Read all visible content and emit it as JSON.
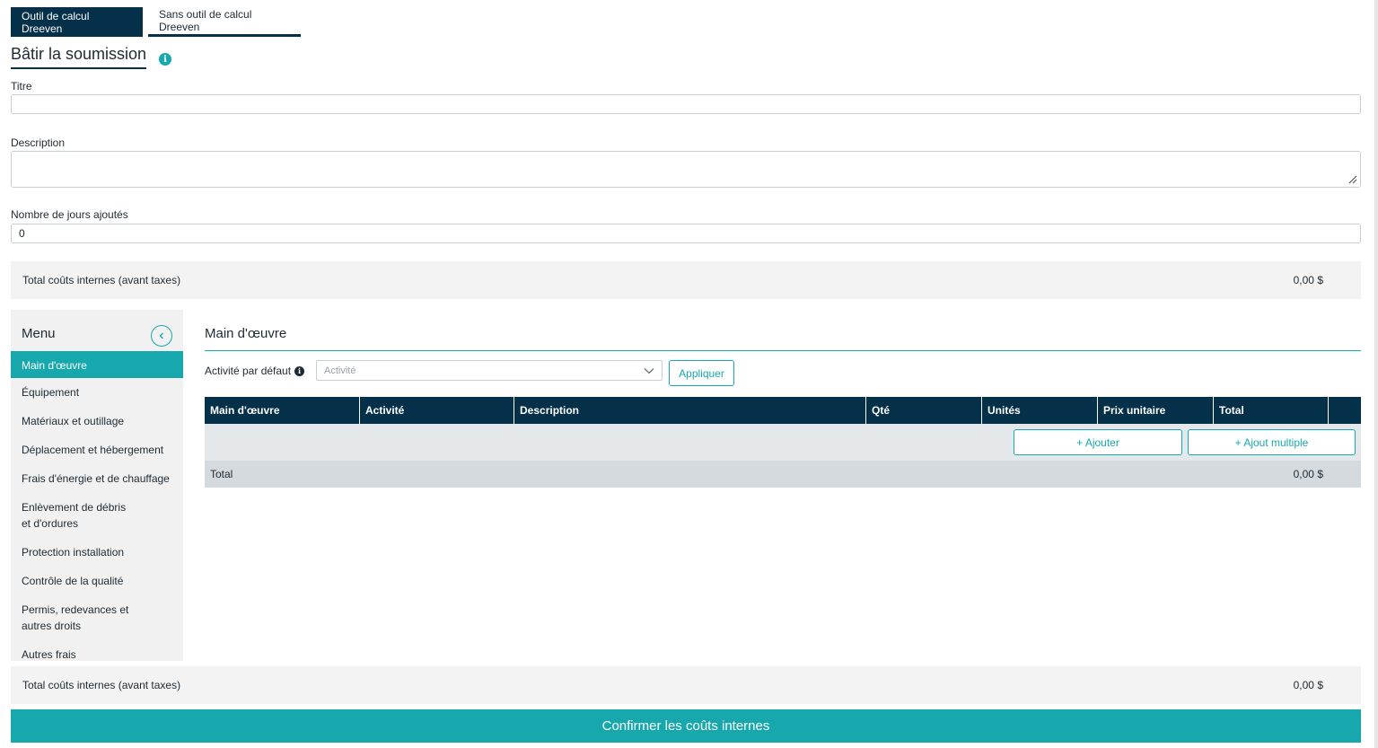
{
  "tabs": [
    {
      "label": "Outil de calcul Dreeven",
      "active": true
    },
    {
      "label": "Sans outil de calcul Dreeven",
      "active": false
    }
  ],
  "page_title": "Bâtir la soumission",
  "info_icon": "info-icon",
  "form": {
    "title_label": "Titre",
    "title_value": "",
    "description_label": "Description",
    "description_value": "",
    "days_label": "Nombre de jours ajoutés",
    "days_value": "0"
  },
  "summary_top": {
    "label": "Total coûts internes (avant taxes)",
    "value": "0,00 $"
  },
  "sidebar": {
    "title": "Menu",
    "collapse_icon": "chevron-left-icon",
    "items": [
      {
        "label": "Main d'œuvre",
        "active": true
      },
      {
        "label": "Équipement"
      },
      {
        "label": "Matériaux et outillage"
      },
      {
        "label": "Déplacement et hébergement"
      },
      {
        "label": "Frais d'énergie et de chauffage"
      },
      {
        "label": "Enlèvement de débris et d'ordures"
      },
      {
        "label": "Protection installation"
      },
      {
        "label": "Contrôle de la qualité"
      },
      {
        "label": "Permis, redevances et autres droits"
      },
      {
        "label": "Autres frais"
      }
    ]
  },
  "main": {
    "title": "Main d'œuvre",
    "activity_label": "Activité par défaut",
    "activity_placeholder": "Activité",
    "apply_label": "Appliquer",
    "table": {
      "columns": [
        "Main d'œuvre",
        "Activité",
        "Description",
        "Qté",
        "Unités",
        "Prix unitaire",
        "Total",
        ""
      ],
      "add_label": "+ Ajouter",
      "add_multiple_label": "+ Ajout multiple",
      "total_label": "Total",
      "total_value": "0,00 $"
    }
  },
  "summary_bottom": {
    "label": "Total coûts internes (avant taxes)",
    "value": "0,00 $"
  },
  "confirm_label": "Confirmer les coûts internes",
  "colors": {
    "primary": "#04304a",
    "accent": "#17a8ae"
  }
}
